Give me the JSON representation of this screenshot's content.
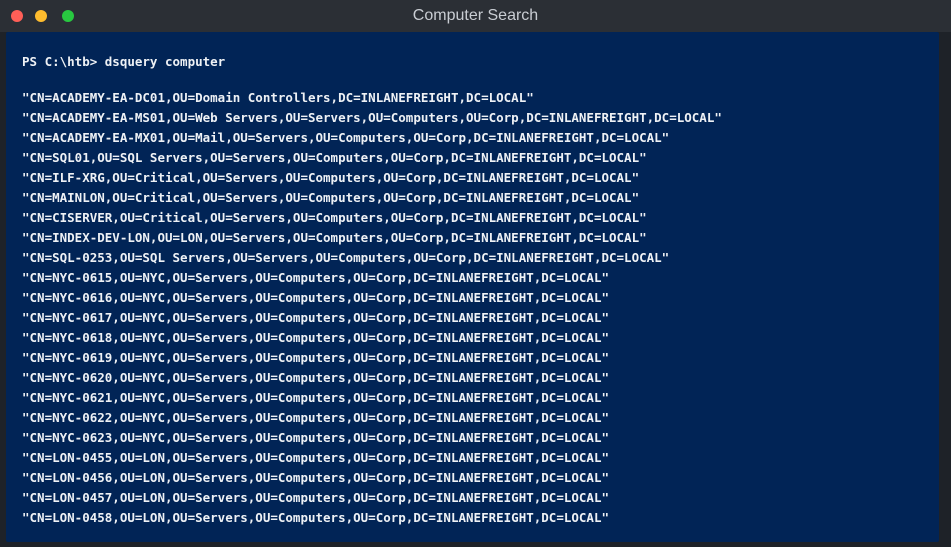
{
  "window": {
    "title": "Computer Search"
  },
  "terminal": {
    "prompt": "PS C:\\htb> dsquery computer",
    "output": [
      "\"CN=ACADEMY-EA-DC01,OU=Domain Controllers,DC=INLANEFREIGHT,DC=LOCAL\"",
      "\"CN=ACADEMY-EA-MS01,OU=Web Servers,OU=Servers,OU=Computers,OU=Corp,DC=INLANEFREIGHT,DC=LOCAL\"",
      "\"CN=ACADEMY-EA-MX01,OU=Mail,OU=Servers,OU=Computers,OU=Corp,DC=INLANEFREIGHT,DC=LOCAL\"",
      "\"CN=SQL01,OU=SQL Servers,OU=Servers,OU=Computers,OU=Corp,DC=INLANEFREIGHT,DC=LOCAL\"",
      "\"CN=ILF-XRG,OU=Critical,OU=Servers,OU=Computers,OU=Corp,DC=INLANEFREIGHT,DC=LOCAL\"",
      "\"CN=MAINLON,OU=Critical,OU=Servers,OU=Computers,OU=Corp,DC=INLANEFREIGHT,DC=LOCAL\"",
      "\"CN=CISERVER,OU=Critical,OU=Servers,OU=Computers,OU=Corp,DC=INLANEFREIGHT,DC=LOCAL\"",
      "\"CN=INDEX-DEV-LON,OU=LON,OU=Servers,OU=Computers,OU=Corp,DC=INLANEFREIGHT,DC=LOCAL\"",
      "\"CN=SQL-0253,OU=SQL Servers,OU=Servers,OU=Computers,OU=Corp,DC=INLANEFREIGHT,DC=LOCAL\"",
      "\"CN=NYC-0615,OU=NYC,OU=Servers,OU=Computers,OU=Corp,DC=INLANEFREIGHT,DC=LOCAL\"",
      "\"CN=NYC-0616,OU=NYC,OU=Servers,OU=Computers,OU=Corp,DC=INLANEFREIGHT,DC=LOCAL\"",
      "\"CN=NYC-0617,OU=NYC,OU=Servers,OU=Computers,OU=Corp,DC=INLANEFREIGHT,DC=LOCAL\"",
      "\"CN=NYC-0618,OU=NYC,OU=Servers,OU=Computers,OU=Corp,DC=INLANEFREIGHT,DC=LOCAL\"",
      "\"CN=NYC-0619,OU=NYC,OU=Servers,OU=Computers,OU=Corp,DC=INLANEFREIGHT,DC=LOCAL\"",
      "\"CN=NYC-0620,OU=NYC,OU=Servers,OU=Computers,OU=Corp,DC=INLANEFREIGHT,DC=LOCAL\"",
      "\"CN=NYC-0621,OU=NYC,OU=Servers,OU=Computers,OU=Corp,DC=INLANEFREIGHT,DC=LOCAL\"",
      "\"CN=NYC-0622,OU=NYC,OU=Servers,OU=Computers,OU=Corp,DC=INLANEFREIGHT,DC=LOCAL\"",
      "\"CN=NYC-0623,OU=NYC,OU=Servers,OU=Computers,OU=Corp,DC=INLANEFREIGHT,DC=LOCAL\"",
      "\"CN=LON-0455,OU=LON,OU=Servers,OU=Computers,OU=Corp,DC=INLANEFREIGHT,DC=LOCAL\"",
      "\"CN=LON-0456,OU=LON,OU=Servers,OU=Computers,OU=Corp,DC=INLANEFREIGHT,DC=LOCAL\"",
      "\"CN=LON-0457,OU=LON,OU=Servers,OU=Computers,OU=Corp,DC=INLANEFREIGHT,DC=LOCAL\"",
      "\"CN=LON-0458,OU=LON,OU=Servers,OU=Computers,OU=Corp,DC=INLANEFREIGHT,DC=LOCAL\""
    ]
  },
  "colors": {
    "terminal_background": "#012456",
    "terminal_text": "#eef1f5",
    "titlebar": "#2b2f35",
    "close": "#ff5f57",
    "minimize": "#febc2e",
    "maximize": "#28c840"
  }
}
